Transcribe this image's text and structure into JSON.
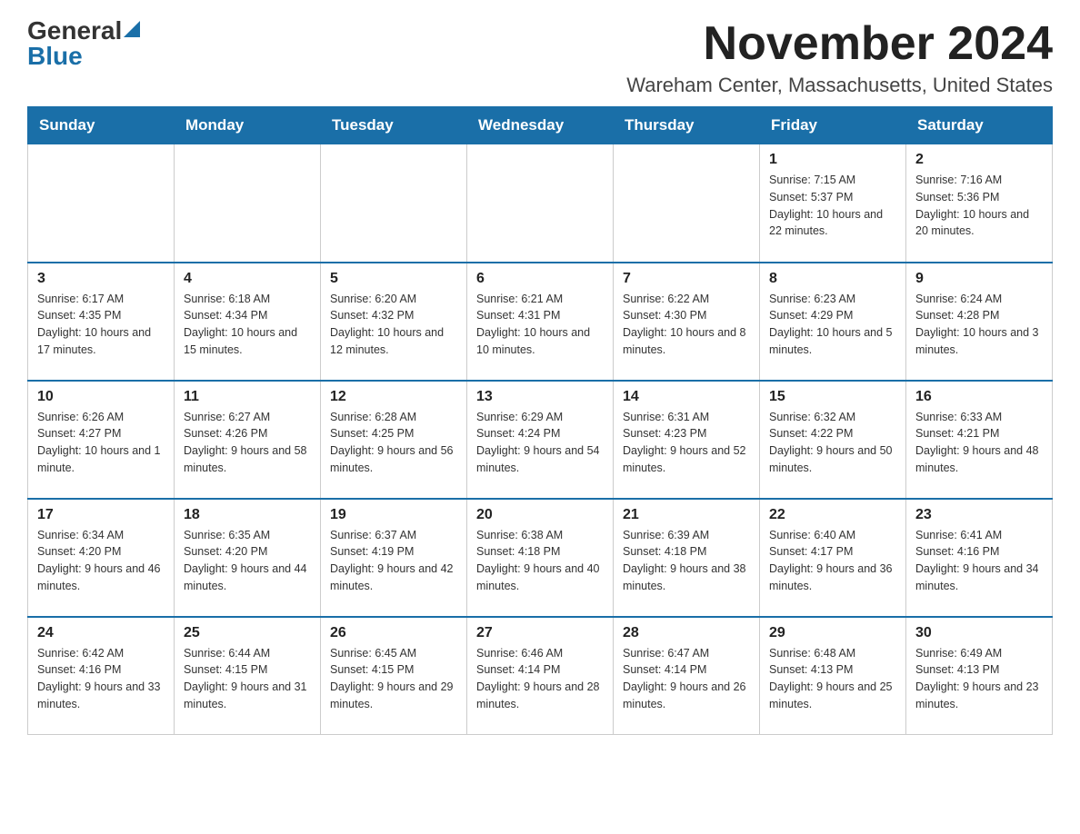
{
  "header": {
    "logo_general": "General",
    "logo_blue": "Blue",
    "month_year": "November 2024",
    "location": "Wareham Center, Massachusetts, United States"
  },
  "weekdays": [
    "Sunday",
    "Monday",
    "Tuesday",
    "Wednesday",
    "Thursday",
    "Friday",
    "Saturday"
  ],
  "weeks": [
    [
      {
        "day": "",
        "info": ""
      },
      {
        "day": "",
        "info": ""
      },
      {
        "day": "",
        "info": ""
      },
      {
        "day": "",
        "info": ""
      },
      {
        "day": "",
        "info": ""
      },
      {
        "day": "1",
        "info": "Sunrise: 7:15 AM\nSunset: 5:37 PM\nDaylight: 10 hours and 22 minutes."
      },
      {
        "day": "2",
        "info": "Sunrise: 7:16 AM\nSunset: 5:36 PM\nDaylight: 10 hours and 20 minutes."
      }
    ],
    [
      {
        "day": "3",
        "info": "Sunrise: 6:17 AM\nSunset: 4:35 PM\nDaylight: 10 hours and 17 minutes."
      },
      {
        "day": "4",
        "info": "Sunrise: 6:18 AM\nSunset: 4:34 PM\nDaylight: 10 hours and 15 minutes."
      },
      {
        "day": "5",
        "info": "Sunrise: 6:20 AM\nSunset: 4:32 PM\nDaylight: 10 hours and 12 minutes."
      },
      {
        "day": "6",
        "info": "Sunrise: 6:21 AM\nSunset: 4:31 PM\nDaylight: 10 hours and 10 minutes."
      },
      {
        "day": "7",
        "info": "Sunrise: 6:22 AM\nSunset: 4:30 PM\nDaylight: 10 hours and 8 minutes."
      },
      {
        "day": "8",
        "info": "Sunrise: 6:23 AM\nSunset: 4:29 PM\nDaylight: 10 hours and 5 minutes."
      },
      {
        "day": "9",
        "info": "Sunrise: 6:24 AM\nSunset: 4:28 PM\nDaylight: 10 hours and 3 minutes."
      }
    ],
    [
      {
        "day": "10",
        "info": "Sunrise: 6:26 AM\nSunset: 4:27 PM\nDaylight: 10 hours and 1 minute."
      },
      {
        "day": "11",
        "info": "Sunrise: 6:27 AM\nSunset: 4:26 PM\nDaylight: 9 hours and 58 minutes."
      },
      {
        "day": "12",
        "info": "Sunrise: 6:28 AM\nSunset: 4:25 PM\nDaylight: 9 hours and 56 minutes."
      },
      {
        "day": "13",
        "info": "Sunrise: 6:29 AM\nSunset: 4:24 PM\nDaylight: 9 hours and 54 minutes."
      },
      {
        "day": "14",
        "info": "Sunrise: 6:31 AM\nSunset: 4:23 PM\nDaylight: 9 hours and 52 minutes."
      },
      {
        "day": "15",
        "info": "Sunrise: 6:32 AM\nSunset: 4:22 PM\nDaylight: 9 hours and 50 minutes."
      },
      {
        "day": "16",
        "info": "Sunrise: 6:33 AM\nSunset: 4:21 PM\nDaylight: 9 hours and 48 minutes."
      }
    ],
    [
      {
        "day": "17",
        "info": "Sunrise: 6:34 AM\nSunset: 4:20 PM\nDaylight: 9 hours and 46 minutes."
      },
      {
        "day": "18",
        "info": "Sunrise: 6:35 AM\nSunset: 4:20 PM\nDaylight: 9 hours and 44 minutes."
      },
      {
        "day": "19",
        "info": "Sunrise: 6:37 AM\nSunset: 4:19 PM\nDaylight: 9 hours and 42 minutes."
      },
      {
        "day": "20",
        "info": "Sunrise: 6:38 AM\nSunset: 4:18 PM\nDaylight: 9 hours and 40 minutes."
      },
      {
        "day": "21",
        "info": "Sunrise: 6:39 AM\nSunset: 4:18 PM\nDaylight: 9 hours and 38 minutes."
      },
      {
        "day": "22",
        "info": "Sunrise: 6:40 AM\nSunset: 4:17 PM\nDaylight: 9 hours and 36 minutes."
      },
      {
        "day": "23",
        "info": "Sunrise: 6:41 AM\nSunset: 4:16 PM\nDaylight: 9 hours and 34 minutes."
      }
    ],
    [
      {
        "day": "24",
        "info": "Sunrise: 6:42 AM\nSunset: 4:16 PM\nDaylight: 9 hours and 33 minutes."
      },
      {
        "day": "25",
        "info": "Sunrise: 6:44 AM\nSunset: 4:15 PM\nDaylight: 9 hours and 31 minutes."
      },
      {
        "day": "26",
        "info": "Sunrise: 6:45 AM\nSunset: 4:15 PM\nDaylight: 9 hours and 29 minutes."
      },
      {
        "day": "27",
        "info": "Sunrise: 6:46 AM\nSunset: 4:14 PM\nDaylight: 9 hours and 28 minutes."
      },
      {
        "day": "28",
        "info": "Sunrise: 6:47 AM\nSunset: 4:14 PM\nDaylight: 9 hours and 26 minutes."
      },
      {
        "day": "29",
        "info": "Sunrise: 6:48 AM\nSunset: 4:13 PM\nDaylight: 9 hours and 25 minutes."
      },
      {
        "day": "30",
        "info": "Sunrise: 6:49 AM\nSunset: 4:13 PM\nDaylight: 9 hours and 23 minutes."
      }
    ]
  ]
}
